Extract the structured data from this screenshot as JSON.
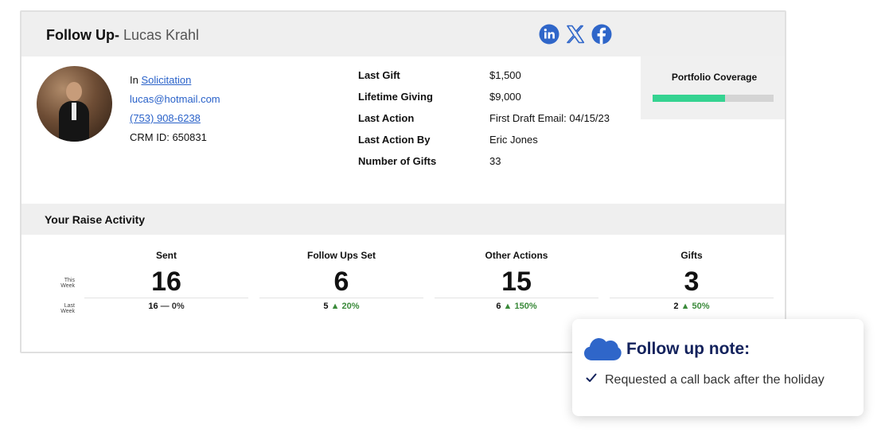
{
  "header": {
    "title_lead": "Follow Up-",
    "contact_name": "Lucas Krahl",
    "social": [
      {
        "icon": "linkedin-icon",
        "color": "#2f66c9"
      },
      {
        "icon": "x-twitter-icon",
        "color": "#2f66c9"
      },
      {
        "icon": "facebook-icon",
        "color": "#2f66c9"
      }
    ]
  },
  "contact": {
    "stage_prefix": "In",
    "stage_link": "Solicitation",
    "email": "lucas@hotmail.com",
    "phone": "(753) 908-6238",
    "crm_id": "CRM ID: 650831"
  },
  "facts": [
    {
      "label": "Last Gift",
      "value": "$1,500"
    },
    {
      "label": "Lifetime Giving",
      "value": "$9,000"
    },
    {
      "label": "Last Action",
      "value": "First Draft Email: 04/15/23"
    },
    {
      "label": "Last Action By",
      "value": "Eric Jones"
    },
    {
      "label": "Number of Gifts",
      "value": "33"
    }
  ],
  "portfolio": {
    "label": "Portfolio Coverage",
    "coverage": 0.6,
    "bar_color": "#35d391"
  },
  "activity": {
    "title": "Your Raise Activity",
    "this_week_label": [
      "This",
      "Week"
    ],
    "last_week_label": [
      "Last",
      "Week"
    ],
    "stats": [
      {
        "label": "Sent",
        "value": "16",
        "last": "16",
        "sep": "—",
        "change": "0%",
        "trend": "flat"
      },
      {
        "label": "Follow Ups Set",
        "value": "6",
        "last": "5",
        "sep": "▲",
        "change": "20%",
        "trend": "up"
      },
      {
        "label": "Other Actions",
        "value": "15",
        "last": "6",
        "sep": "▲",
        "change": "150%",
        "trend": "up"
      },
      {
        "label": "Gifts",
        "value": "3",
        "last": "2",
        "sep": "▲",
        "change": "50%",
        "trend": "up"
      }
    ]
  },
  "note": {
    "title": "Follow up note:",
    "item": "Requested a call back after the holiday",
    "accent": "#2f66c9",
    "title_color": "#13225c"
  }
}
